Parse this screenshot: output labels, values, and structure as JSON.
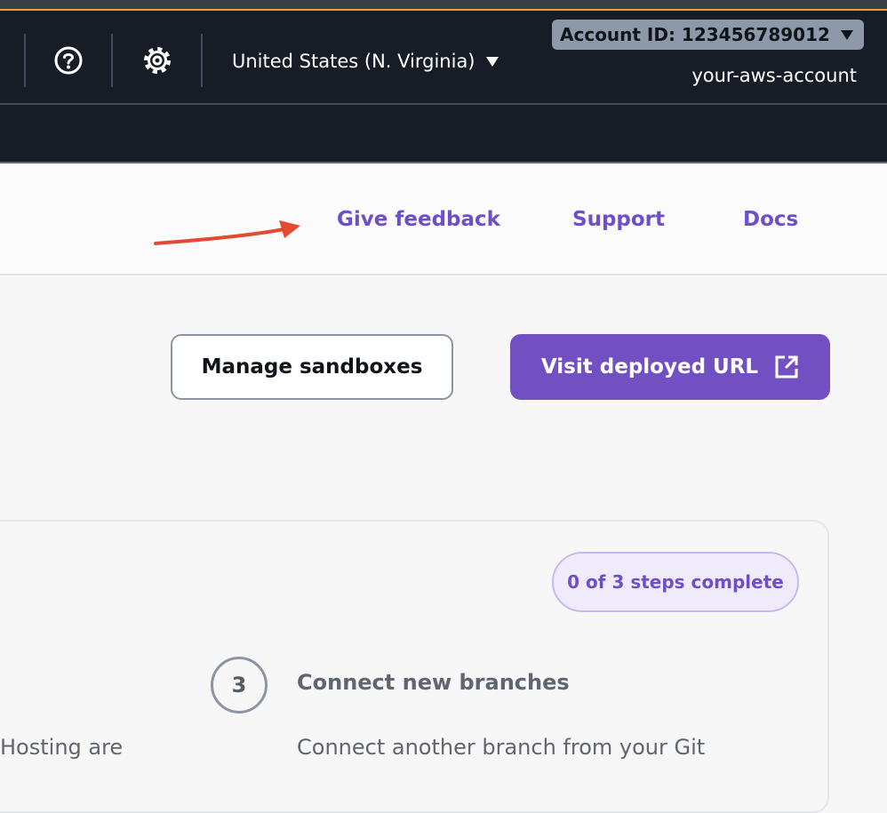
{
  "topnav": {
    "help_icon": "help-circle-icon",
    "settings_icon": "gear-icon",
    "region_label": "United States (N. Virginia)",
    "account_id_label": "Account ID: 123456789012",
    "account_name": "your-aws-account"
  },
  "header_links": {
    "feedback": "Give feedback",
    "support": "Support",
    "docs": "Docs"
  },
  "actions": {
    "manage_sandboxes": "Manage sandboxes",
    "visit_url": "Visit deployed URL",
    "visit_url_icon": "external-link-icon"
  },
  "getting_started": {
    "progress": "0 of 3 steps complete",
    "steps_total": 3,
    "steps_done": 0,
    "prev_step_fragment": "Hosting are",
    "step": {
      "number": "3",
      "title": "Connect new branches",
      "description": "Connect another branch from your Git"
    }
  },
  "colors": {
    "nav_bg": "#161d26",
    "accent_orange": "#e7a23b",
    "link_purple": "#6f4fc7",
    "primary_button": "#7250c2",
    "annotation_arrow": "#e34a33"
  }
}
